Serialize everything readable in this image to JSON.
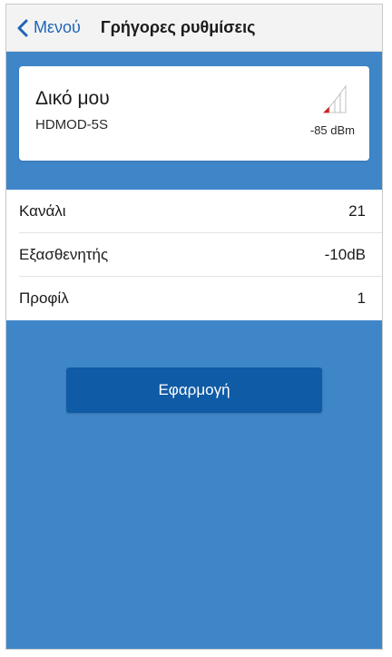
{
  "header": {
    "back_label": "Μενού",
    "title": "Γρήγορες ρυθμίσεις"
  },
  "device": {
    "name": "Δικό μου",
    "model": "HDMOD-5S",
    "signal": "-85 dBm",
    "signal_bars_active": 1,
    "signal_bars_total": 4,
    "accent_color": "#d11f1f"
  },
  "settings": {
    "rows": [
      {
        "label": "Κανάλι",
        "value": "21"
      },
      {
        "label": "Εξασθενητής",
        "value": "-10dB"
      },
      {
        "label": "Προφίλ",
        "value": "1"
      }
    ]
  },
  "actions": {
    "apply_label": "Εφαρμογή"
  },
  "colors": {
    "background_blue": "#3f86c8",
    "button_blue": "#105ba6",
    "link_blue": "#1e64b4"
  }
}
